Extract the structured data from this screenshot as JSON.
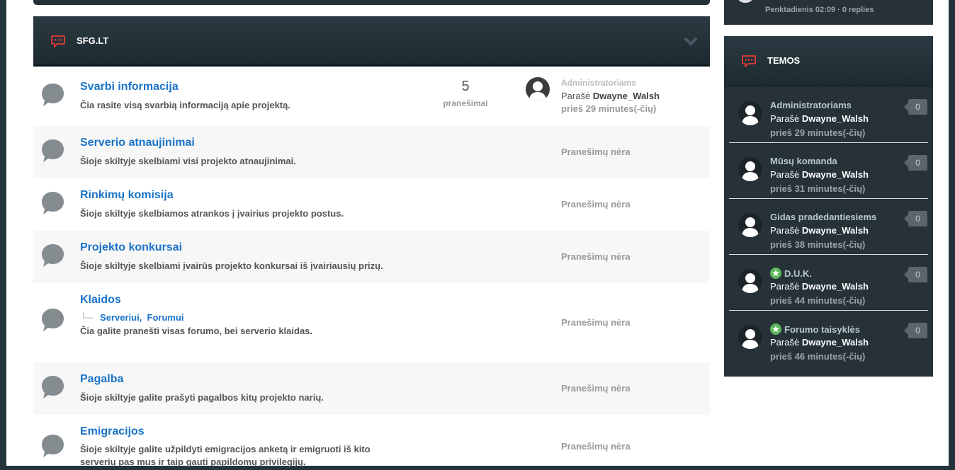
{
  "category": {
    "title": "SFG.LT"
  },
  "sidebar_prev": {
    "meta": "Penktadienis 02:09 · 0 replies"
  },
  "forums": [
    {
      "title": "Svarbi informacija",
      "desc": "Čia rasite visą svarbią informaciją apie projektą.",
      "stats": {
        "count": "5",
        "label": "pranešimai"
      },
      "last_post": {
        "topic": "Administratoriams",
        "by_prefix": "Parašė",
        "author": "Dwayne_Walsh",
        "time": "prieš 29 minutes(-čių)"
      }
    },
    {
      "title": "Serverio atnaujinimai",
      "desc": "Šioje skiltyje skelbiami visi projekto atnaujinimai.",
      "no_posts": "Pranešimų nėra"
    },
    {
      "title": "Rinkimų komisija",
      "desc": "Šioje skiltyje skelbiamos atrankos į įvairius projekto postus.",
      "no_posts": "Pranešimų nėra"
    },
    {
      "title": "Projekto konkursai",
      "desc": "Šioje skiltyje skelbiami įvairūs projekto konkursai iš įvairiausių prizų.",
      "no_posts": "Pranešimų nėra"
    },
    {
      "title": "Klaidos",
      "subforums": [
        "Serveriui,",
        "Forumui"
      ],
      "desc": "Čia galite pranešti visas forumo, bei serverio klaidas.",
      "no_posts": "Pranešimų nėra"
    },
    {
      "title": "Pagalba",
      "desc": "Šioje skiltyje galite prašyti pagalbos kitų projekto narių.",
      "no_posts": "Pranešimų nėra"
    },
    {
      "title": "Emigracijos",
      "desc": "Šioje skiltyje galite užpildyti emigracijos anketą ir emigruoti iš kito",
      "desc2": "serverių pas mus ir taip gauti papildomų privilegijų.",
      "no_posts": "Pranešimų nėra"
    }
  ],
  "sidebar": {
    "title": "TEMOS",
    "topics": [
      {
        "title": "Administratoriams",
        "by_prefix": "Parašė",
        "author": "Dwayne_Walsh",
        "time": "prieš 29 minutes(-čių)",
        "replies": "0",
        "pinned": false
      },
      {
        "title": "Mūsų komanda",
        "by_prefix": "Parašė",
        "author": "Dwayne_Walsh",
        "time": "prieš 31 minutes(-čių)",
        "replies": "0",
        "pinned": false
      },
      {
        "title": "Gidas pradedantiesiems",
        "by_prefix": "Parašė",
        "author": "Dwayne_Walsh",
        "time": "prieš 38 minutes(-čių)",
        "replies": "0",
        "pinned": false
      },
      {
        "title": "D.U.K.",
        "by_prefix": "Parašė",
        "author": "Dwayne_Walsh",
        "time": "prieš 44 minutes(-čių)",
        "replies": "0",
        "pinned": true
      },
      {
        "title": "Forumo taisyklės",
        "by_prefix": "Parašė",
        "author": "Dwayne_Walsh",
        "time": "prieš 46 minutes(-čių)",
        "replies": "0",
        "pinned": true
      }
    ]
  },
  "colors": {
    "accent": "#1a73c8",
    "header_bg": "#263238",
    "icon_red": "#e53935",
    "pinned": "#5cb85c"
  }
}
